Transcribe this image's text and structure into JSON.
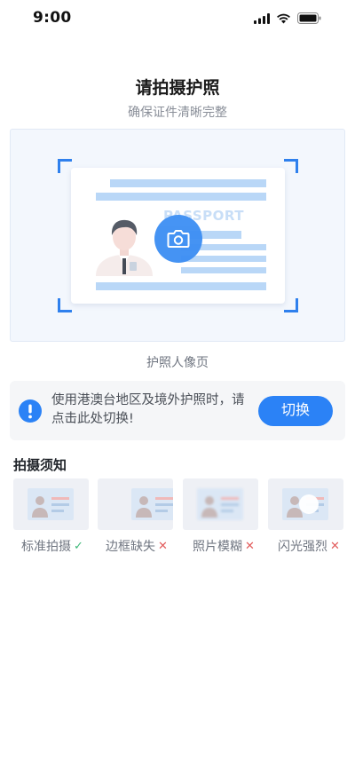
{
  "status_bar": {
    "time": "9:00"
  },
  "header": {
    "title": "请拍摄护照",
    "subtitle": "确保证件清晰完整"
  },
  "capture": {
    "passport_word": "PASSPORT",
    "label": "护照人像页"
  },
  "notice": {
    "text": "使用港澳台地区及境外护照时，请点击此处切换!",
    "button_label": "切换"
  },
  "tips": {
    "heading": "拍摄须知",
    "items": [
      {
        "label": "标准拍摄",
        "status": "ok"
      },
      {
        "label": "边框缺失",
        "status": "no"
      },
      {
        "label": "照片模糊",
        "status": "no"
      },
      {
        "label": "闪光强烈",
        "status": "no"
      }
    ]
  },
  "colors": {
    "accent": "#2b82f6",
    "ok": "#3cb878",
    "error": "#e25c5c"
  }
}
